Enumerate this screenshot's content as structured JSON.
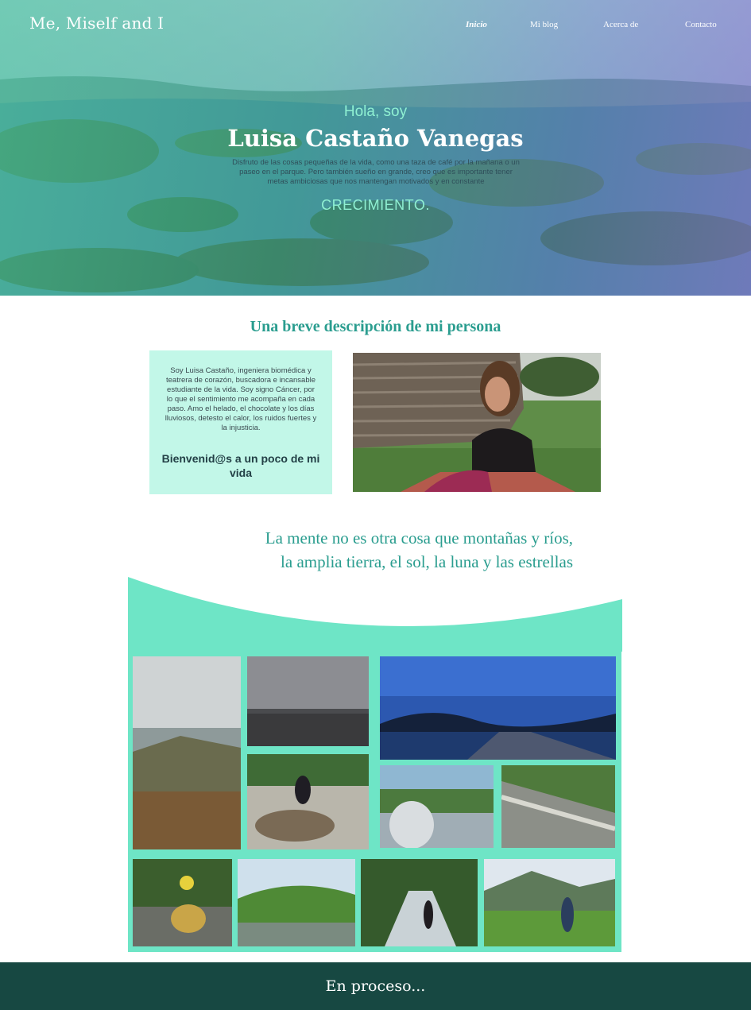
{
  "header": {
    "brand": "Me, Miself and I",
    "nav": [
      {
        "label": "Inicio",
        "active": true
      },
      {
        "label": "Mi blog",
        "active": false
      },
      {
        "label": "Acerca de",
        "active": false
      },
      {
        "label": "Contacto",
        "active": false
      }
    ]
  },
  "hero": {
    "greeting": "Hola, soy",
    "name": "Luisa Castaño Vanegas",
    "description": "Disfruto de las cosas pequeñas de la vida, como una taza de café por la mañana o un paseo en el parque. Pero también sueño en grande, creo que es importante tener metas ambiciosas que nos mantengan motivados y en constante",
    "highlight": "CRECIMIENTO."
  },
  "about": {
    "title": "Una breve descripción de mi persona",
    "bio": "Soy Luisa Castaño, ingeniera biomédica y teatrera de corazón, buscadora e incansable estudiante de la vida. Soy signo Cáncer, por lo que el sentimiento me acompaña en cada paso. Amo el helado, el chocolate y los días lluviosos, detesto el calor, los ruidos fuertes y la injusticia.",
    "welcome": "Bienvenid@s a un poco de mi vida"
  },
  "quote": {
    "line1": "La mente no es otra cosa que montañas y ríos,",
    "line2": "la amplia tierra, el sol, la luna y las estrellas"
  },
  "footer": {
    "text": "En proceso..."
  },
  "colors": {
    "accent": "#2a9d8f",
    "mint": "#6ee5c6",
    "card": "#c2f7e8",
    "footer": "#174842"
  }
}
